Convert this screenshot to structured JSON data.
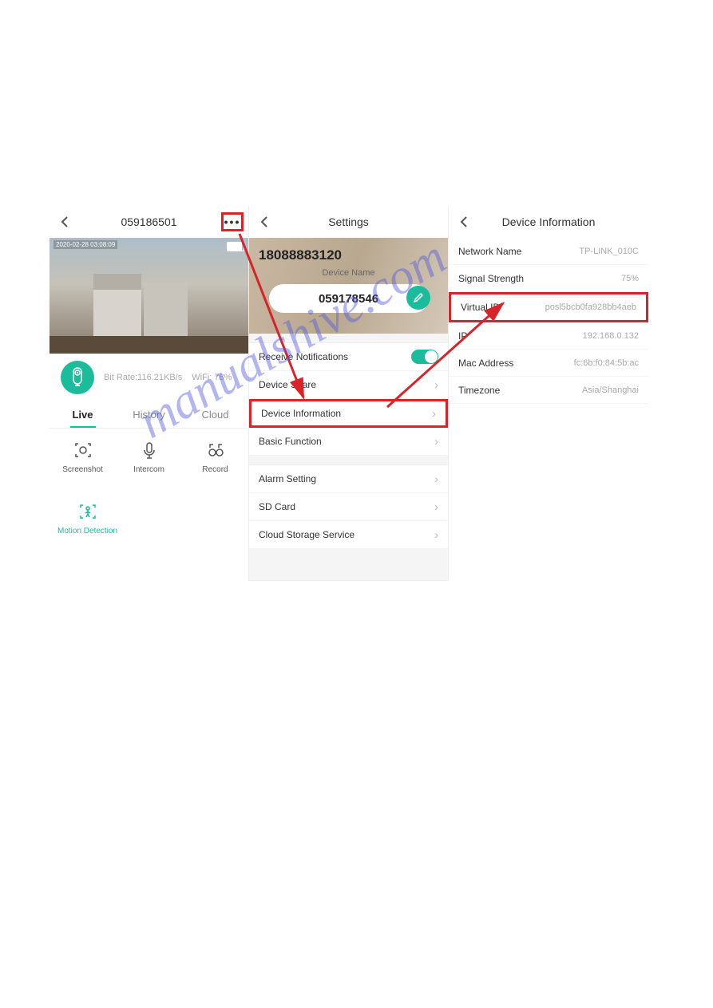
{
  "watermark": "manualshive.com",
  "screen1": {
    "title": "059186501",
    "video_timestamp": "2020-02-28 03:08:09",
    "bitrate": "Bit Rate:116.21KB/s",
    "wifi": "WiFi: 78%",
    "tabs": {
      "live": "Live",
      "history": "History",
      "cloud": "Cloud"
    },
    "controls": {
      "screenshot": "Screenshot",
      "intercom": "Intercom",
      "record": "Record",
      "motion": "Motion Detection"
    }
  },
  "screen2": {
    "title": "Settings",
    "phone": "18088883120",
    "devname_label": "Device Name",
    "devname": "059178546",
    "rows": {
      "notif": "Receive Notifications",
      "share": "Device Share",
      "info": "Device Information",
      "basic": "Basic Function",
      "alarm": "Alarm Setting",
      "sd": "SD Card",
      "cloud": "Cloud Storage Service"
    }
  },
  "screen3": {
    "title": "Device Information",
    "rows": {
      "network_k": "Network Name",
      "network_v": "TP-LINK_010C",
      "signal_k": "Signal Strength",
      "signal_v": "75%",
      "vid_k": "Virtual ID",
      "vid_v": "posl5bcb0fa928bb4aeb",
      "ip_k": "IP",
      "ip_v": "192.168.0.132",
      "mac_k": "Mac Address",
      "mac_v": "fc:6b:f0:84:5b:ac",
      "tz_k": "Timezone",
      "tz_v": "Asia/Shanghai"
    }
  }
}
